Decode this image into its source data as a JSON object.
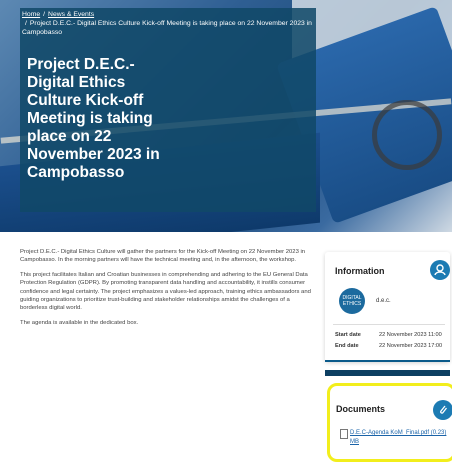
{
  "breadcrumb": {
    "home": "Home",
    "section": "News & Events",
    "current": "Project D.E.C.- Digital Ethics Culture Kick-off Meeting is taking place on 22 November 2023 in Campobasso"
  },
  "hero": {
    "title": "Project D.E.C.- Digital Ethics Culture Kick-off Meeting is taking place on 22 November 2023 in Campobasso"
  },
  "body": {
    "paragraphs": [
      "Project D.E.C.- Digital Ethics Culture will gather the partners for the Kick-off Meeting on 22 November 2023 in Campobasso. In the morning partners will have the technical meeting and, in the afternoon, the workshop.",
      "This project facilitates Italian and Croatian businesses in comprehending and adhering to the EU General Data Protection Regulation (GDPR). By promoting transparent data handling and accountability, it instills consumer confidence and legal certainty. The project emphasizes a values-led approach, training ethics ambassadors and guiding organizations to prioritize trust-building and stakeholder relationships amidst the challenges of a borderless digital world.",
      "The agenda is available in the dedicated box."
    ]
  },
  "information": {
    "title": "Information",
    "icon": "person-icon",
    "logo_text": "DIGITAL ETHICS",
    "project_name": "d.e.c.",
    "start_label": "Start date",
    "start_value": "22 November 2023 11:00",
    "end_label": "End date",
    "end_value": "22 November 2023 17:00"
  },
  "documents": {
    "title": "Documents",
    "icon": "paperclip-icon",
    "file": "D.E.C-Agenda KoM_Final.pdf (0.23) MB",
    "highlight_color": "#f2ee1c"
  }
}
